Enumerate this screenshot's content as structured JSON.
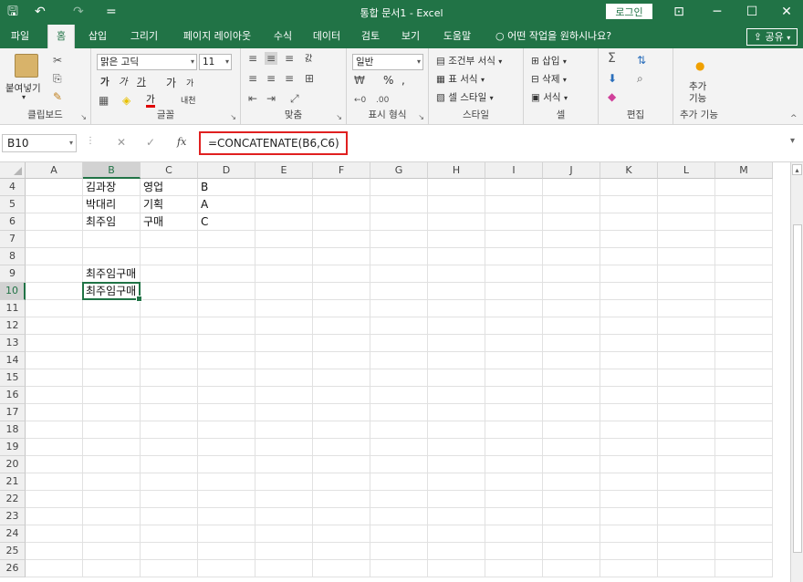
{
  "app": {
    "title": "통합 문서1  -  Excel",
    "login": "로그인",
    "window_icons": {
      "ribbon_display": "⊡",
      "minimize": "─",
      "maximize": "☐",
      "close": "✕"
    },
    "quick_access": {
      "save": "🖫",
      "undo": "↶",
      "redo": "↷",
      "customize": "="
    }
  },
  "tabs": [
    {
      "label": "파일",
      "active": false
    },
    {
      "label": "홈",
      "active": true
    },
    {
      "label": "삽입",
      "active": false
    },
    {
      "label": "그리기",
      "active": false
    },
    {
      "label": "페이지 레이아웃",
      "active": false
    },
    {
      "label": "수식",
      "active": false
    },
    {
      "label": "데이터",
      "active": false
    },
    {
      "label": "검토",
      "active": false
    },
    {
      "label": "보기",
      "active": false
    },
    {
      "label": "도움말",
      "active": false
    }
  ],
  "tell_me": "어떤 작업을 원하시나요?",
  "share": "공유",
  "ribbon": {
    "clipboard": {
      "label": "클립보드",
      "paste": "붙여넣기"
    },
    "font": {
      "label": "글꼴",
      "font_name": "맑은 고딕",
      "font_size": "11",
      "grow": "가",
      "shrink": "가",
      "bold": "가",
      "italic": "가",
      "underline": "가",
      "font_color": "가",
      "phonetic": "내천"
    },
    "alignment": {
      "label": "맞춤",
      "wrap": "갌"
    },
    "number": {
      "label": "표시 형식",
      "format": "일반",
      "percent": "%",
      "comma": ","
    },
    "styles": {
      "label": "스타일",
      "conditional": "조건부 서식",
      "table": "표 서식",
      "cell": "셀 스타일"
    },
    "cells": {
      "label": "셀",
      "insert": "삽입",
      "delete": "삭제",
      "format": "서식"
    },
    "editing": {
      "label": "편집"
    },
    "addins": {
      "label": "추가 기능",
      "button": "추가\n기능"
    }
  },
  "formula_bar": {
    "name_box": "B10",
    "fx": "fx",
    "formula": "=CONCATENATE(B6,C6)"
  },
  "grid": {
    "columns": [
      "A",
      "B",
      "C",
      "D",
      "E",
      "F",
      "G",
      "H",
      "I",
      "J",
      "K",
      "L",
      "M"
    ],
    "selected_column": "B",
    "rows": [
      {
        "num": "4",
        "cells": {
          "B": "김과장",
          "C": "영업",
          "D": "B"
        }
      },
      {
        "num": "5",
        "cells": {
          "B": "박대리",
          "C": "기획",
          "D": "A"
        }
      },
      {
        "num": "6",
        "cells": {
          "B": "최주임",
          "C": "구매",
          "D": "C"
        }
      },
      {
        "num": "7",
        "cells": {}
      },
      {
        "num": "8",
        "cells": {}
      },
      {
        "num": "9",
        "cells": {
          "B": "최주임구매"
        }
      },
      {
        "num": "10",
        "cells": {
          "B": "최주임구매"
        }
      },
      {
        "num": "11",
        "cells": {}
      },
      {
        "num": "12",
        "cells": {}
      },
      {
        "num": "13",
        "cells": {}
      },
      {
        "num": "14",
        "cells": {}
      },
      {
        "num": "15",
        "cells": {}
      },
      {
        "num": "16",
        "cells": {}
      },
      {
        "num": "17",
        "cells": {}
      },
      {
        "num": "18",
        "cells": {}
      },
      {
        "num": "19",
        "cells": {}
      },
      {
        "num": "20",
        "cells": {}
      },
      {
        "num": "21",
        "cells": {}
      },
      {
        "num": "22",
        "cells": {}
      },
      {
        "num": "23",
        "cells": {}
      },
      {
        "num": "24",
        "cells": {}
      },
      {
        "num": "25",
        "cells": {}
      },
      {
        "num": "26",
        "cells": {}
      }
    ],
    "active_cell": {
      "col": "B",
      "row": "10"
    }
  },
  "colors": {
    "brand": "#217346",
    "highlight_border": "#e02020"
  }
}
